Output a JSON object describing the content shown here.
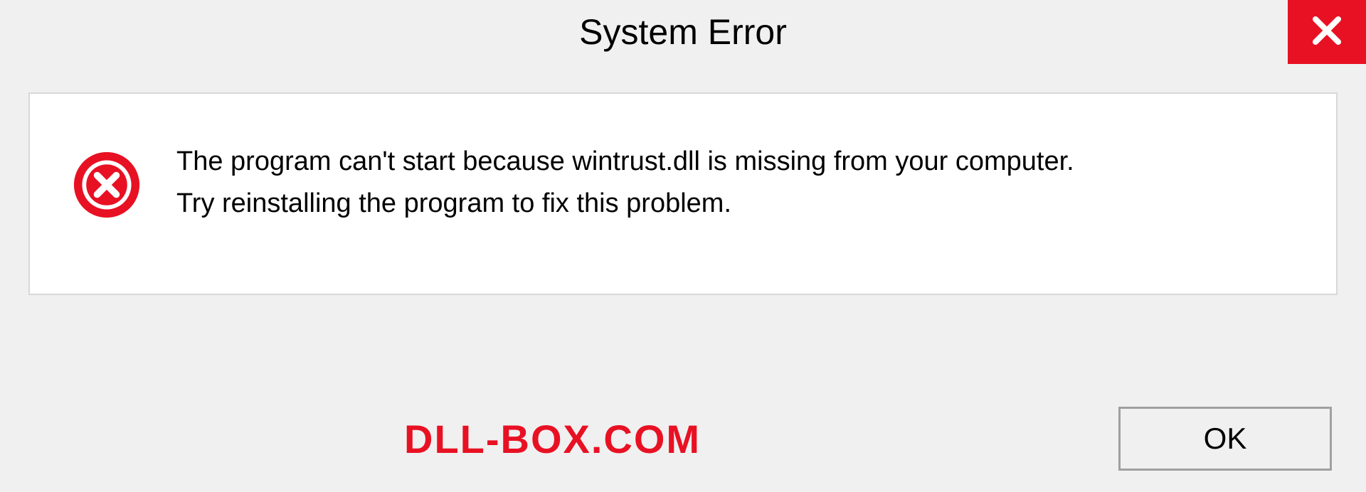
{
  "dialog": {
    "title": "System Error",
    "message_line1": "The program can't start because wintrust.dll is missing from your computer.",
    "message_line2": "Try reinstalling the program to fix this problem.",
    "ok_label": "OK"
  },
  "watermark": {
    "text": "DLL-BOX.COM"
  },
  "icons": {
    "close": "close-icon",
    "error": "error-circle-icon"
  },
  "colors": {
    "accent_red": "#e81123",
    "background": "#f0f0f0",
    "panel_bg": "#ffffff",
    "border": "#d8d8d8"
  }
}
